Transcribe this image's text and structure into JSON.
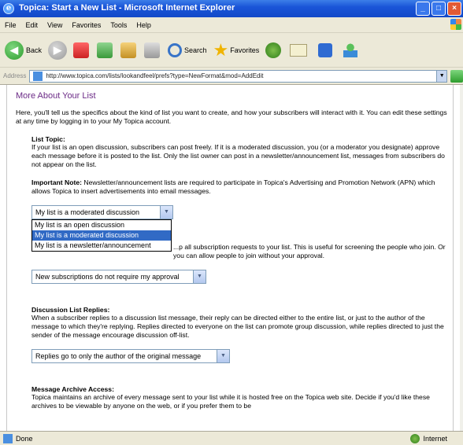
{
  "window": {
    "title": "Topica: Start a New List - Microsoft Internet Explorer",
    "btn_minimize": "_",
    "btn_maximize": "□",
    "btn_close": "×"
  },
  "menu": [
    "File",
    "Edit",
    "View",
    "Favorites",
    "Tools",
    "Help"
  ],
  "toolbar": {
    "back": "Back",
    "search": "Search",
    "favorites": "Favorites"
  },
  "address": {
    "label": "Address",
    "url": "http://www.topica.com/lists/lookandfeel/prefs?type=NewFormat&mod=AddEdit"
  },
  "page": {
    "title": "More About Your List",
    "intro": "Here, you'll tell us the specifics about the kind of list you want to create, and how your subscribers will interact with it. You can edit these settings at any time by logging in to your My Topica account.",
    "list_topic": {
      "title": "List Topic:",
      "body": "If your list is an open discussion, subscribers can post freely. If it is a moderated discussion, you (or a moderator you designate) approve each message before it is posted to the list. Only the list owner can post in a newsletter/announcement list, messages from subscribers do not appear on the list."
    },
    "important": {
      "label": "Important Note:",
      "body": "Newsletter/announcement lists are required to participate in Topica's Advertising and Promotion Network (APN) which allows Topica to insert advertisements into email messages."
    },
    "list_type_select": {
      "value": "My list is a moderated discussion",
      "options": [
        "My list is an open discussion",
        "My list is a moderated discussion",
        "My list is a newsletter/announcement"
      ],
      "selected_index": 1
    },
    "subscription": {
      "body": "...p all subscription requests to your list. This is useful for screening the people who join. Or you can allow people to join without your approval."
    },
    "subscription_select": {
      "value": "New subscriptions do not require my approval"
    },
    "replies": {
      "title": "Discussion List Replies:",
      "body": "When a subscriber replies to a discussion list message, their reply can be directed either to the entire list, or just to the author of the message to which they're replying. Replies directed to everyone on the list can promote group discussion, while replies directed to just the sender of the message encourage discussion off-list."
    },
    "replies_select": {
      "value": "Replies go to only the author of the original message"
    },
    "archives": {
      "title": "Message Archive Access:",
      "body": "Topica maintains an archive of every message sent to your list while it is hosted free on the Topica web site. Decide if you'd like these archives to be viewable by anyone on the web, or if you prefer them to be"
    }
  },
  "status": {
    "left": "Done",
    "zone": "Internet"
  }
}
